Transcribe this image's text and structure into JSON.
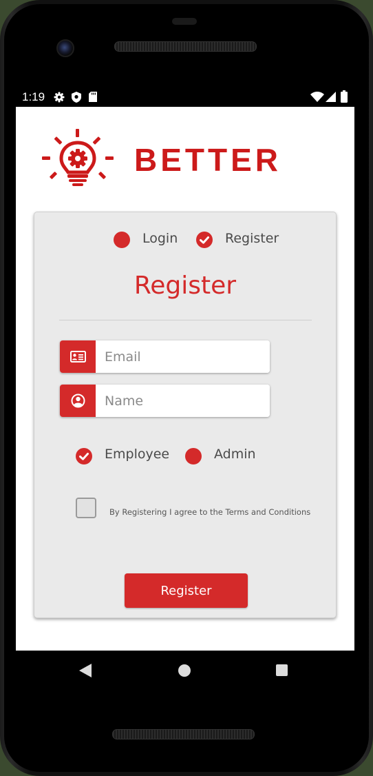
{
  "status_bar": {
    "time": "1:19",
    "icons": [
      "settings-icon",
      "shield-icon",
      "sd-card-icon",
      "wifi-icon",
      "signal-icon",
      "battery-icon"
    ]
  },
  "logo": {
    "text": "BETTER",
    "icon": "lightbulb-gear-icon",
    "color": "#cc1a1a"
  },
  "mode_toggle": {
    "options": [
      {
        "label": "Login",
        "selected": false
      },
      {
        "label": "Register",
        "selected": true
      }
    ]
  },
  "form": {
    "title": "Register",
    "email": {
      "placeholder": "Email",
      "value": "",
      "icon": "id-card-icon"
    },
    "name": {
      "placeholder": "Name",
      "value": "",
      "icon": "user-icon"
    },
    "roles": [
      {
        "label": "Employee",
        "selected": true
      },
      {
        "label": "Admin",
        "selected": false
      }
    ],
    "terms": {
      "label": "By Registering I agree to the Terms and Conditions",
      "checked": false
    },
    "submit_label": "Register"
  },
  "nav": {
    "icons": [
      "back-icon",
      "home-icon",
      "recents-icon"
    ]
  },
  "colors": {
    "accent": "#d42a2a",
    "card_bg": "#eaeaea",
    "text": "#4a4a4a"
  }
}
